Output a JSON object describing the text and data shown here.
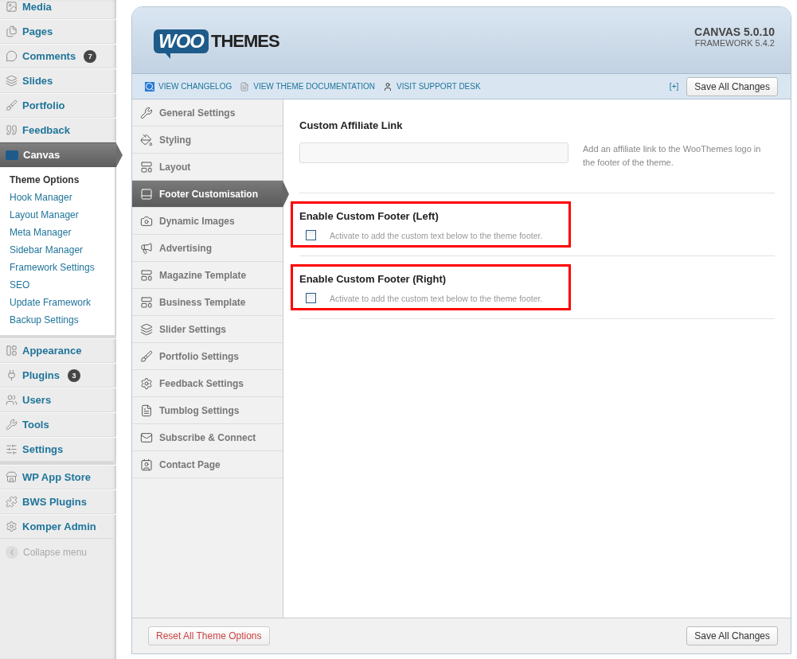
{
  "sidebar": {
    "groups": [
      {
        "items": [
          {
            "label": "Media",
            "selected": false
          },
          {
            "label": "Pages",
            "selected": false
          },
          {
            "label": "Comments",
            "selected": false,
            "badge": "7"
          },
          {
            "label": "Slides",
            "selected": false
          },
          {
            "label": "Portfolio",
            "selected": false
          },
          {
            "label": "Feedback",
            "selected": false
          },
          {
            "label": "Canvas",
            "selected": true,
            "children": [
              {
                "label": "Theme Options",
                "selected": true
              },
              {
                "label": "Hook Manager",
                "selected": false
              },
              {
                "label": "Layout Manager",
                "selected": false
              },
              {
                "label": "Meta Manager",
                "selected": false
              },
              {
                "label": "Sidebar Manager",
                "selected": false
              },
              {
                "label": "Framework Settings",
                "selected": false
              },
              {
                "label": "SEO",
                "selected": false
              },
              {
                "label": "Update Framework",
                "selected": false
              },
              {
                "label": "Backup Settings",
                "selected": false
              }
            ]
          }
        ]
      },
      {
        "items": [
          {
            "label": "Appearance",
            "selected": false
          },
          {
            "label": "Plugins",
            "selected": false,
            "badge": "3"
          },
          {
            "label": "Users",
            "selected": false
          },
          {
            "label": "Tools",
            "selected": false
          },
          {
            "label": "Settings",
            "selected": false
          }
        ]
      },
      {
        "items": [
          {
            "label": "WP App Store",
            "selected": false
          },
          {
            "label": "BWS Plugins",
            "selected": false
          },
          {
            "label": "Komper Admin",
            "selected": false
          }
        ]
      }
    ],
    "collapse_label": "Collapse menu"
  },
  "header": {
    "logo_part_1": "WOO",
    "logo_part_2": "THEMES",
    "version": "CANVAS 5.0.10",
    "framework": "FRAMEWORK 5.4.2"
  },
  "toolbar": {
    "links": [
      "VIEW CHANGELOG",
      "VIEW THEME DOCUMENTATION",
      "VISIT SUPPORT DESK"
    ],
    "expand": "[+]",
    "save": "Save All Changes"
  },
  "options_nav": [
    {
      "label": "General Settings",
      "selected": false
    },
    {
      "label": "Styling",
      "selected": false
    },
    {
      "label": "Layout",
      "selected": false
    },
    {
      "label": "Footer Customisation",
      "selected": true
    },
    {
      "label": "Dynamic Images",
      "selected": false
    },
    {
      "label": "Advertising",
      "selected": false
    },
    {
      "label": "Magazine Template",
      "selected": false
    },
    {
      "label": "Business Template",
      "selected": false
    },
    {
      "label": "Slider Settings",
      "selected": false
    },
    {
      "label": "Portfolio Settings",
      "selected": false
    },
    {
      "label": "Feedback Settings",
      "selected": false
    },
    {
      "label": "Tumblog Settings",
      "selected": false
    },
    {
      "label": "Subscribe & Connect",
      "selected": false
    },
    {
      "label": "Contact Page",
      "selected": false
    }
  ],
  "fields": [
    {
      "kind": "text",
      "label": "Custom Affiliate Link",
      "help": "Add an affiliate link to the WooThemes logo in the footer of the theme.",
      "highlighted": false
    },
    {
      "kind": "checkbox",
      "label": "Enable Custom Footer (Left)",
      "checked": false,
      "help": "Activate to add the custom text below to the theme footer.",
      "highlighted": true
    },
    {
      "kind": "checkbox",
      "label": "Enable Custom Footer (Right)",
      "checked": false,
      "help": "Activate to add the custom text below to the theme footer.",
      "highlighted": true
    }
  ],
  "footer": {
    "reset": "Reset All Theme Options",
    "save": "Save All Changes"
  }
}
